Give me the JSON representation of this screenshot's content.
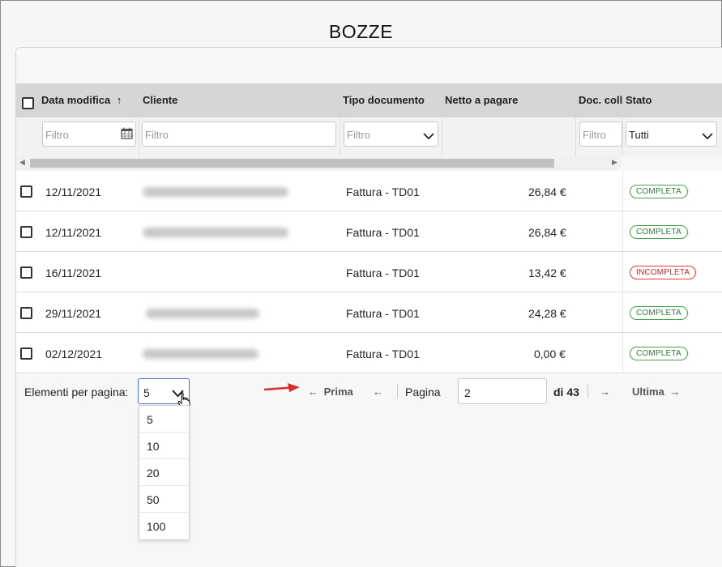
{
  "page": {
    "title": "BOZZE"
  },
  "table": {
    "columns": [
      "Data modifica",
      "Cliente",
      "Tipo documento",
      "Netto a pagare",
      "Doc. coll",
      "Stato"
    ],
    "sort_indicator": "↑",
    "filters": {
      "data_placeholder": "Filtro",
      "cliente_placeholder": "Filtro",
      "tipo_placeholder": "Filtro",
      "doc_placeholder": "Filtro",
      "stato_value": "Tutti"
    },
    "rows": [
      {
        "date": "12/11/2021",
        "tipo": "Fattura - TD01",
        "netto": "26,84 €",
        "stato": "COMPLETA"
      },
      {
        "date": "12/11/2021",
        "tipo": "Fattura - TD01",
        "netto": "26,84 €",
        "stato": "COMPLETA"
      },
      {
        "date": "16/11/2021",
        "tipo": "Fattura - TD01",
        "netto": "13,42 €",
        "stato": "INCOMPLETA"
      },
      {
        "date": "29/11/2021",
        "tipo": "Fattura - TD01",
        "netto": "24,28 €",
        "stato": "COMPLETA"
      },
      {
        "date": "02/12/2021",
        "tipo": "Fattura - TD01",
        "netto": "0,00 €",
        "stato": "COMPLETA"
      }
    ]
  },
  "pagination": {
    "per_page_label": "Elementi per pagina:",
    "per_page_value": "5",
    "per_page_options": [
      "5",
      "10",
      "20",
      "50",
      "100"
    ],
    "first_label": "Prima",
    "page_label": "Pagina",
    "page_value": "2",
    "of_label": "di 43",
    "last_label": "Ultima"
  },
  "icons": {
    "calendar": "calendar-icon",
    "arrow_left": "←",
    "arrow_right": "→",
    "chevron": "chevron-down-icon"
  },
  "colors": {
    "completa": "#43a047",
    "incompleta": "#e53935",
    "dropdown_border": "#4a72c4",
    "annotation_arrow": "#d32f2f"
  }
}
